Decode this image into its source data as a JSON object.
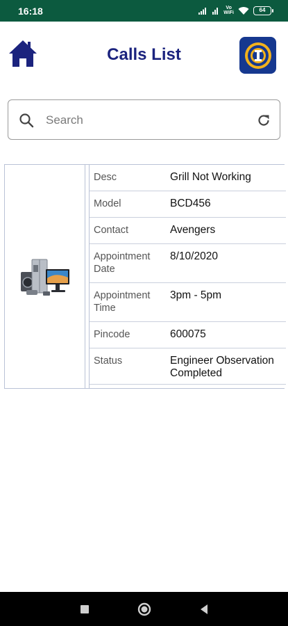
{
  "status_bar": {
    "time": "16:18",
    "volte_line1": "Vo",
    "volte_line2": "WiFi",
    "battery": "64"
  },
  "header": {
    "title": "Calls List",
    "home_icon": "home-icon",
    "logo_icon": "app-logo"
  },
  "search": {
    "placeholder": "Search",
    "value": ""
  },
  "call": {
    "image": "home-appliances-image",
    "fields": [
      {
        "label": "Desc",
        "value": "Grill Not Working"
      },
      {
        "label": "Model",
        "value": "BCD456"
      },
      {
        "label": "Contact",
        "value": "Avengers"
      },
      {
        "label": "Appointment Date",
        "value": "8/10/2020"
      },
      {
        "label": "Appointment Time",
        "value": "3pm - 5pm"
      },
      {
        "label": "Pincode",
        "value": "600075"
      },
      {
        "label": "Status",
        "value": "Engineer Observation Completed"
      }
    ]
  },
  "colors": {
    "status_bar": "#0c5a3f",
    "title": "#1b237e",
    "home_icon": "#1b237e",
    "logo_bg": "#16388f",
    "logo_accent": "#f2b11c"
  }
}
